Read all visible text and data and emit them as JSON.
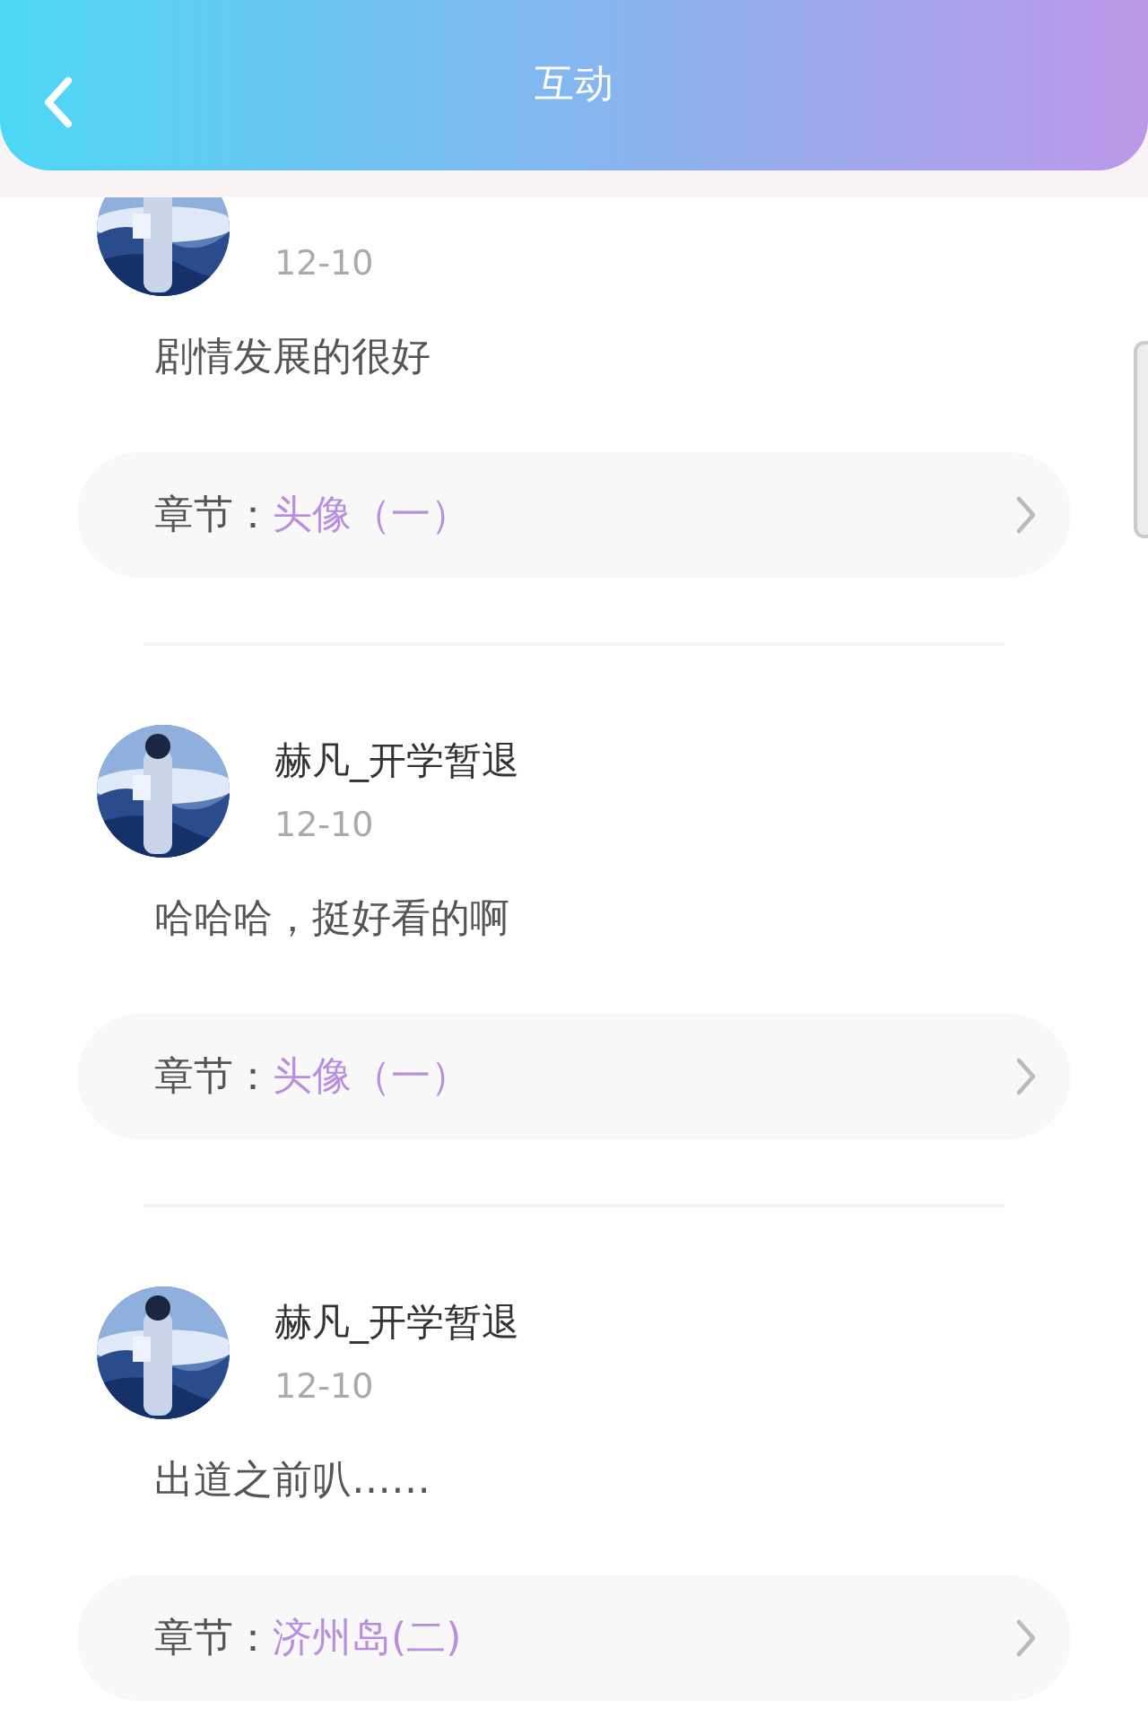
{
  "header": {
    "title": "互动"
  },
  "comments": [
    {
      "date": "12-10",
      "text": "剧情发展的很好",
      "chapter_label": "章节：",
      "chapter": "头像（一）"
    },
    {
      "user": "赫凡_开学暂退",
      "date": "12-10",
      "text": "哈哈哈，挺好看的啊",
      "chapter_label": "章节：",
      "chapter": "头像（一）"
    },
    {
      "user": "赫凡_开学暂退",
      "date": "12-10",
      "text": "出道之前叭……",
      "chapter_label": "章节：",
      "chapter": "济州岛(二)"
    }
  ]
}
